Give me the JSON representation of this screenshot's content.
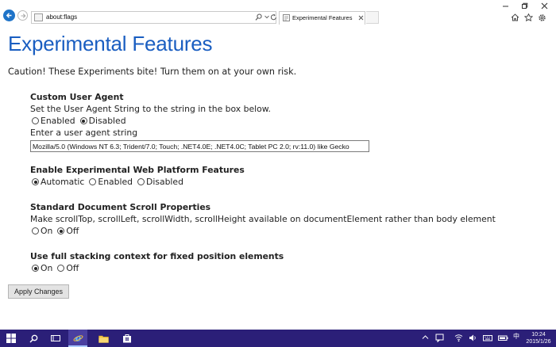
{
  "browser": {
    "address": "about:flags",
    "tab_title": "Experimental Features"
  },
  "page": {
    "title": "Experimental Features",
    "caution": "Caution! These Experiments bite! Turn them on at your own risk.",
    "apply_label": "Apply Changes"
  },
  "sections": {
    "user_agent": {
      "title": "Custom User Agent",
      "description": "Set the User Agent String to the string in the box below.",
      "options": [
        "Enabled",
        "Disabled"
      ],
      "selected": "Disabled",
      "input_label": "Enter a user agent string",
      "input_value": "Mozilla/5.0 (Windows NT 6.3; Trident/7.0; Touch; .NET4.0E; .NET4.0C; Tablet PC 2.0; rv:11.0) like Gecko"
    },
    "web_platform": {
      "title": "Enable Experimental Web Platform Features",
      "options": [
        "Automatic",
        "Enabled",
        "Disabled"
      ],
      "selected": "Automatic"
    },
    "scroll": {
      "title": "Standard Document Scroll Properties",
      "description": "Make scrollTop, scrollLeft, scrollWidth, scrollHeight available on documentElement rather than body element",
      "options": [
        "On",
        "Off"
      ],
      "selected": "Off"
    },
    "stacking": {
      "title": "Use full stacking context for fixed position elements",
      "options": [
        "On",
        "Off"
      ],
      "selected": "On"
    }
  },
  "taskbar": {
    "ime": "中",
    "time": "10:24",
    "date": "2015/1/26"
  },
  "colors": {
    "title_blue": "#1a5ec1",
    "taskbar": "#2b1f78",
    "back_button": "#1e73c8"
  }
}
